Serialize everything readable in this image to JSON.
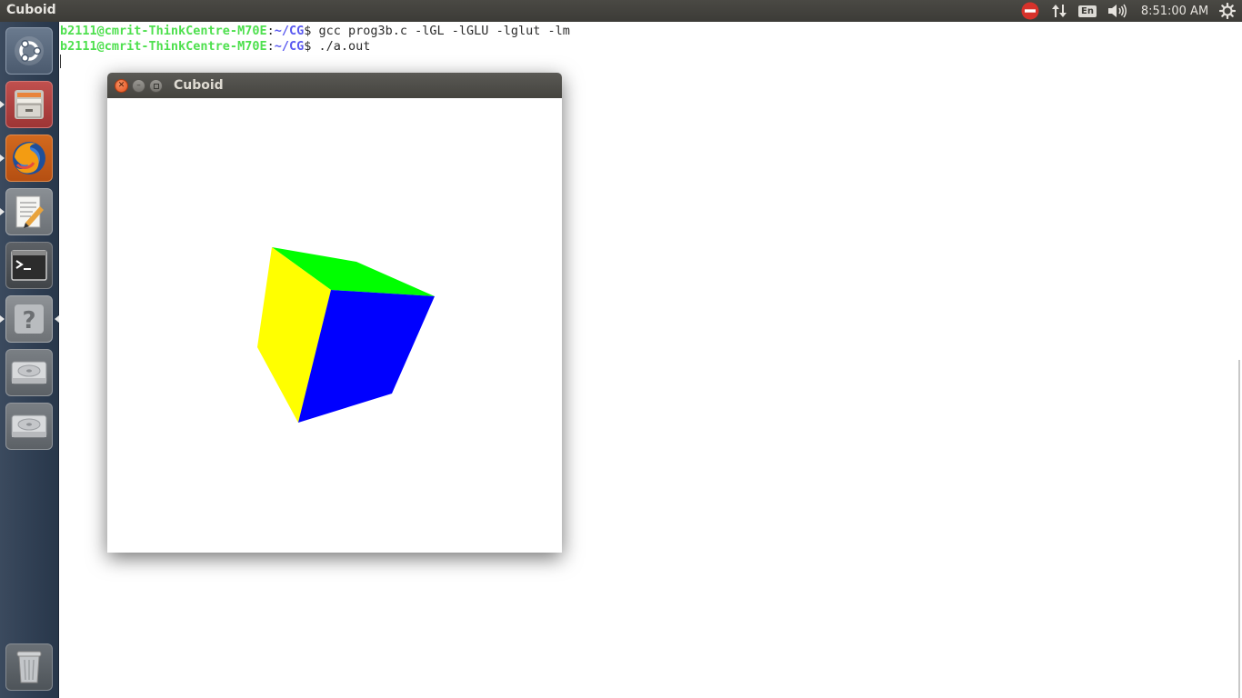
{
  "top_panel": {
    "app_title": "Cuboid",
    "language": "En",
    "clock": "8:51:00 AM",
    "icons": [
      "no-entry-icon",
      "network-arrows-icon",
      "keyboard-language-icon",
      "volume-icon",
      "gear-icon"
    ]
  },
  "launcher": {
    "items": [
      "ubuntu-dash-icon",
      "files-icon",
      "firefox-icon",
      "text-editor-icon",
      "terminal-icon",
      "help-icon",
      "drive-icon",
      "drive-icon",
      "trash-icon"
    ]
  },
  "terminal": {
    "lines": [
      {
        "user": "b2111@cmrit-ThinkCentre-M70E",
        "sep": ":",
        "path": "~/CG",
        "prompt": "$ ",
        "command": "gcc prog3b.c -lGL -lGLU -lglut -lm"
      },
      {
        "user": "b2111@cmrit-ThinkCentre-M70E",
        "sep": ":",
        "path": "~/CG",
        "prompt": "$ ",
        "command": "./a.out"
      }
    ]
  },
  "window": {
    "title": "Cuboid",
    "faces": [
      {
        "name": "green",
        "color": "#00ff00"
      },
      {
        "name": "yellow",
        "color": "#ffff00"
      },
      {
        "name": "blue",
        "color": "#0000ff"
      }
    ]
  },
  "colors": {
    "prompt_user": "#4ee04e",
    "prompt_path": "#5a5af0",
    "panel_bg": "#3c3b37",
    "close_button": "#e5531f"
  }
}
